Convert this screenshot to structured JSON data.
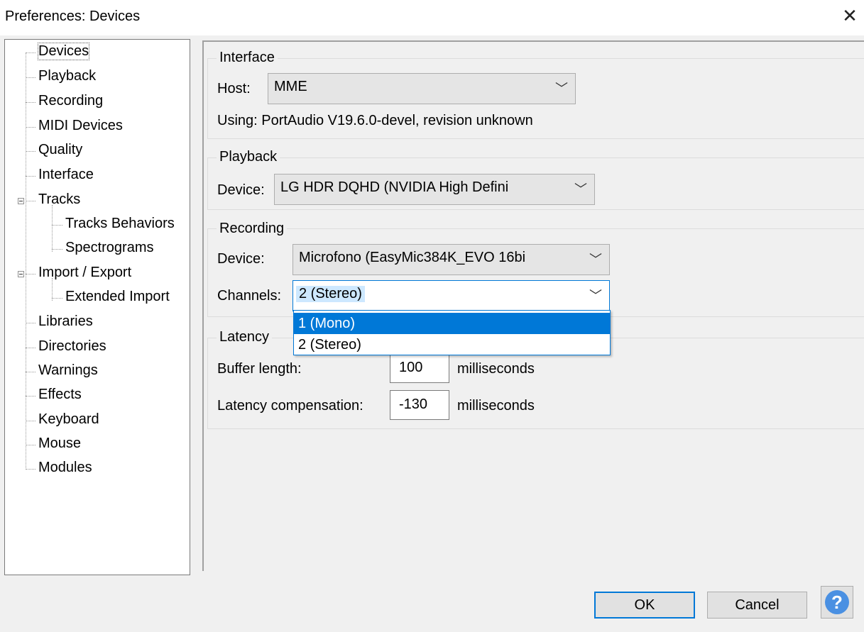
{
  "window": {
    "title": "Preferences: Devices",
    "close_glyph": "✕"
  },
  "tree": {
    "items": [
      {
        "label": "Devices"
      },
      {
        "label": "Playback"
      },
      {
        "label": "Recording"
      },
      {
        "label": "MIDI Devices"
      },
      {
        "label": "Quality"
      },
      {
        "label": "Interface"
      },
      {
        "label": "Tracks"
      },
      {
        "label": "Tracks Behaviors"
      },
      {
        "label": "Spectrograms"
      },
      {
        "label": "Import / Export"
      },
      {
        "label": "Extended Import"
      },
      {
        "label": "Libraries"
      },
      {
        "label": "Directories"
      },
      {
        "label": "Warnings"
      },
      {
        "label": "Effects"
      },
      {
        "label": "Keyboard"
      },
      {
        "label": "Mouse"
      },
      {
        "label": "Modules"
      }
    ],
    "selected": "Devices"
  },
  "interface": {
    "title": "Interface",
    "host_label": "Host:",
    "host_value": "MME",
    "using_text": "Using: PortAudio V19.6.0-devel, revision unknown"
  },
  "playback": {
    "title": "Playback",
    "device_label": "Device:",
    "device_value": "LG HDR DQHD (NVIDIA High Defini"
  },
  "recording": {
    "title": "Recording",
    "device_label": "Device:",
    "device_value": "Microfono (EasyMic384K_EVO 16bi",
    "channels_label": "Channels:",
    "channels_value": "2 (Stereo)",
    "channels_options": [
      "1 (Mono)",
      "2 (Stereo)"
    ],
    "highlighted_option": "1 (Mono)"
  },
  "latency": {
    "title": "Latency",
    "buffer_label": "Buffer length:",
    "buffer_value": "100",
    "buffer_unit": "milliseconds",
    "comp_label": "Latency compensation:",
    "comp_value": "-130",
    "comp_unit": "milliseconds"
  },
  "buttons": {
    "ok": "OK",
    "cancel": "Cancel",
    "help": "?"
  },
  "colors": {
    "accent": "#0078d7",
    "selection_bg": "#cde8ff",
    "help_icon": "#4a90e2"
  }
}
